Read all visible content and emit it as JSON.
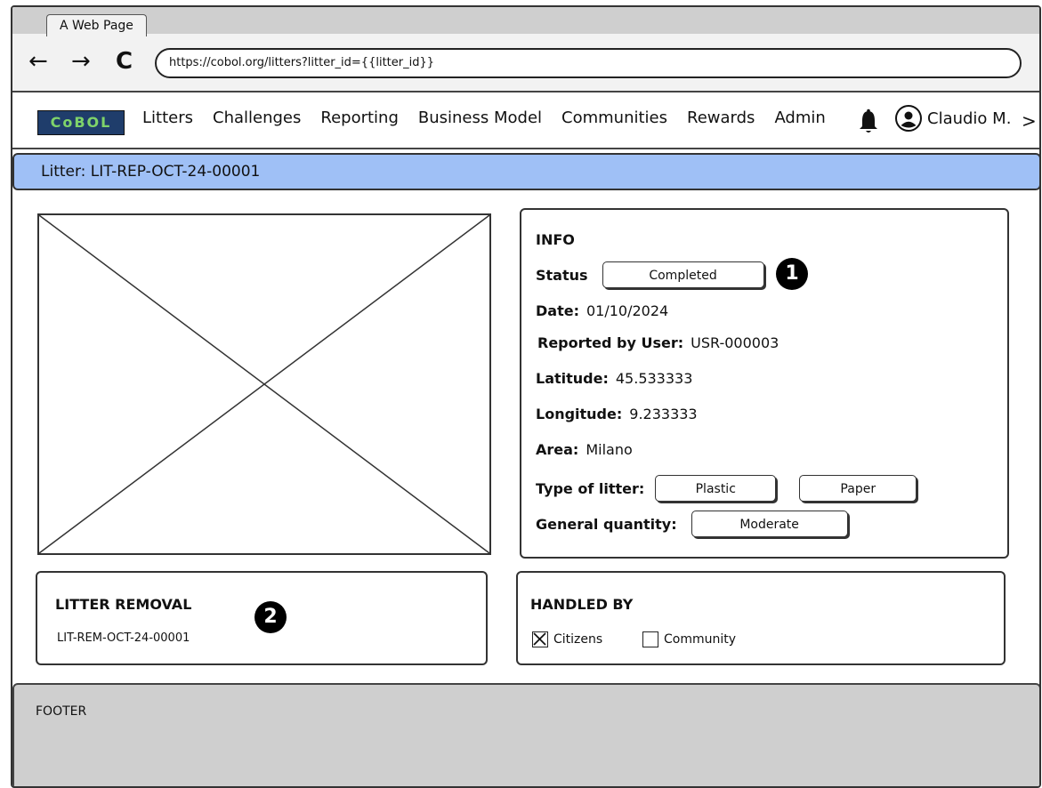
{
  "browser": {
    "tab_title": "A Web Page",
    "url": "https://cobol.org/litters?litter_id={{litter_id}}",
    "back_glyph": "←",
    "forward_glyph": "→",
    "reload_glyph": "C"
  },
  "nav": {
    "logo_text": "CoBOL",
    "items": [
      "Litters",
      "Challenges",
      "Reporting",
      "Business Model",
      "Communities",
      "Rewards",
      "Admin"
    ],
    "user_name": "Claudio M.",
    "more_glyph": ">"
  },
  "page": {
    "title": "Litter: LIT-REP-OCT-24-00001"
  },
  "info": {
    "heading": "INFO",
    "status_label": "Status",
    "status_value": "Completed",
    "date_label": "Date:",
    "date_value": "01/10/2024",
    "reported_label": "Reported by User:",
    "reported_value": "USR-000003",
    "latitude_label": "Latitude:",
    "latitude_value": "45.533333",
    "longitude_label": "Longitude:",
    "longitude_value": "9.233333",
    "area_label": "Area:",
    "area_value": "Milano",
    "type_label": "Type of litter:",
    "types": [
      "Plastic",
      "Paper"
    ],
    "quantity_label": "General quantity:",
    "quantity_value": "Moderate"
  },
  "removal": {
    "heading": "LITTER REMOVAL",
    "id": "LIT-REM-OCT-24-00001"
  },
  "handled": {
    "heading": "HANDLED BY",
    "options": [
      {
        "label": "Citizens",
        "checked": true
      },
      {
        "label": "Community",
        "checked": false
      }
    ]
  },
  "annotations": [
    "1",
    "2"
  ],
  "footer": {
    "label": "FOOTER"
  },
  "colors": {
    "title_bar": "#9fc0f6",
    "footer_bg": "#cfcfcf",
    "logo_bg": "#1f3d6b",
    "logo_fg": "#7fd36a"
  }
}
